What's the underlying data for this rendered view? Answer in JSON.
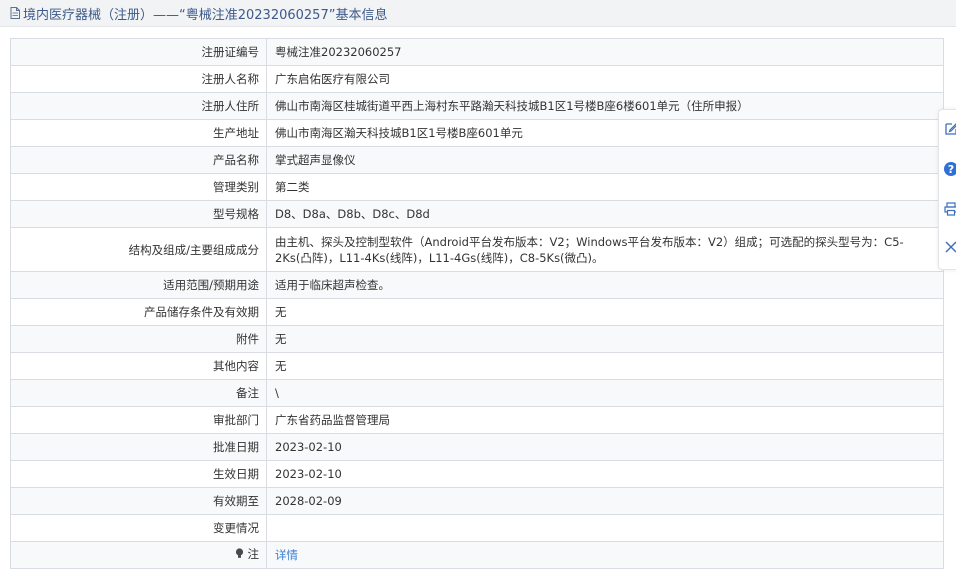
{
  "header": {
    "title": "境内医疗器械（注册）——“粤械注准20232060257”基本信息"
  },
  "rows": [
    {
      "label": "注册证编号",
      "value": "粤械注准20232060257"
    },
    {
      "label": "注册人名称",
      "value": "广东启佑医疗有限公司"
    },
    {
      "label": "注册人住所",
      "value": "佛山市南海区桂城街道平西上海村东平路瀚天科技城B1区1号楼B座6楼601单元（住所申报）"
    },
    {
      "label": "生产地址",
      "value": "佛山市南海区瀚天科技城B1区1号楼B座601单元"
    },
    {
      "label": "产品名称",
      "value": "掌式超声显像仪"
    },
    {
      "label": "管理类别",
      "value": "第二类"
    },
    {
      "label": "型号规格",
      "value": "D8、D8a、D8b、D8c、D8d"
    },
    {
      "label": "结构及组成/主要组成成分",
      "value": "由主机、探头及控制型软件（Android平台发布版本：V2；Windows平台发布版本：V2）组成；可选配的探头型号为：C5-2Ks(凸阵)，L11-4Ks(线阵)，L11-4Gs(线阵)，C8-5Ks(微凸)。"
    },
    {
      "label": "适用范围/预期用途",
      "value": "适用于临床超声检查。"
    },
    {
      "label": "产品储存条件及有效期",
      "value": "无"
    },
    {
      "label": "附件",
      "value": "无"
    },
    {
      "label": "其他内容",
      "value": "无"
    },
    {
      "label": "备注",
      "value": "\\"
    },
    {
      "label": "审批部门",
      "value": "广东省药品监督管理局"
    },
    {
      "label": "批准日期",
      "value": "2023-02-10"
    },
    {
      "label": "生效日期",
      "value": "2023-02-10"
    },
    {
      "label": "有效期至",
      "value": "2028-02-09"
    },
    {
      "label": "变更情况",
      "value": ""
    }
  ],
  "note_row": {
    "label": "注",
    "link": "详情"
  },
  "float_toolbar": {
    "items": [
      "edit-icon",
      "help-icon",
      "print-icon",
      "close-icon"
    ]
  }
}
